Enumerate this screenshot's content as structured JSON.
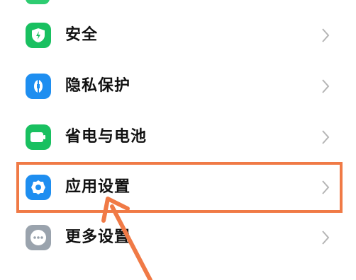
{
  "settings": {
    "items": [
      {
        "label": "安全",
        "icon": "shield-icon",
        "color": "#19c060"
      },
      {
        "label": "隐私保护",
        "icon": "privacy-icon",
        "color": "#1e8ef0"
      },
      {
        "label": "省电与电池",
        "icon": "battery-icon",
        "color": "#19c060"
      },
      {
        "label": "应用设置",
        "icon": "gear-icon",
        "color": "#1e8ef0"
      },
      {
        "label": "更多设置",
        "icon": "more-icon",
        "color": "#9aa3ad"
      }
    ],
    "highlighted_item": "应用设置"
  },
  "annotation": {
    "color": "#f07a46"
  }
}
